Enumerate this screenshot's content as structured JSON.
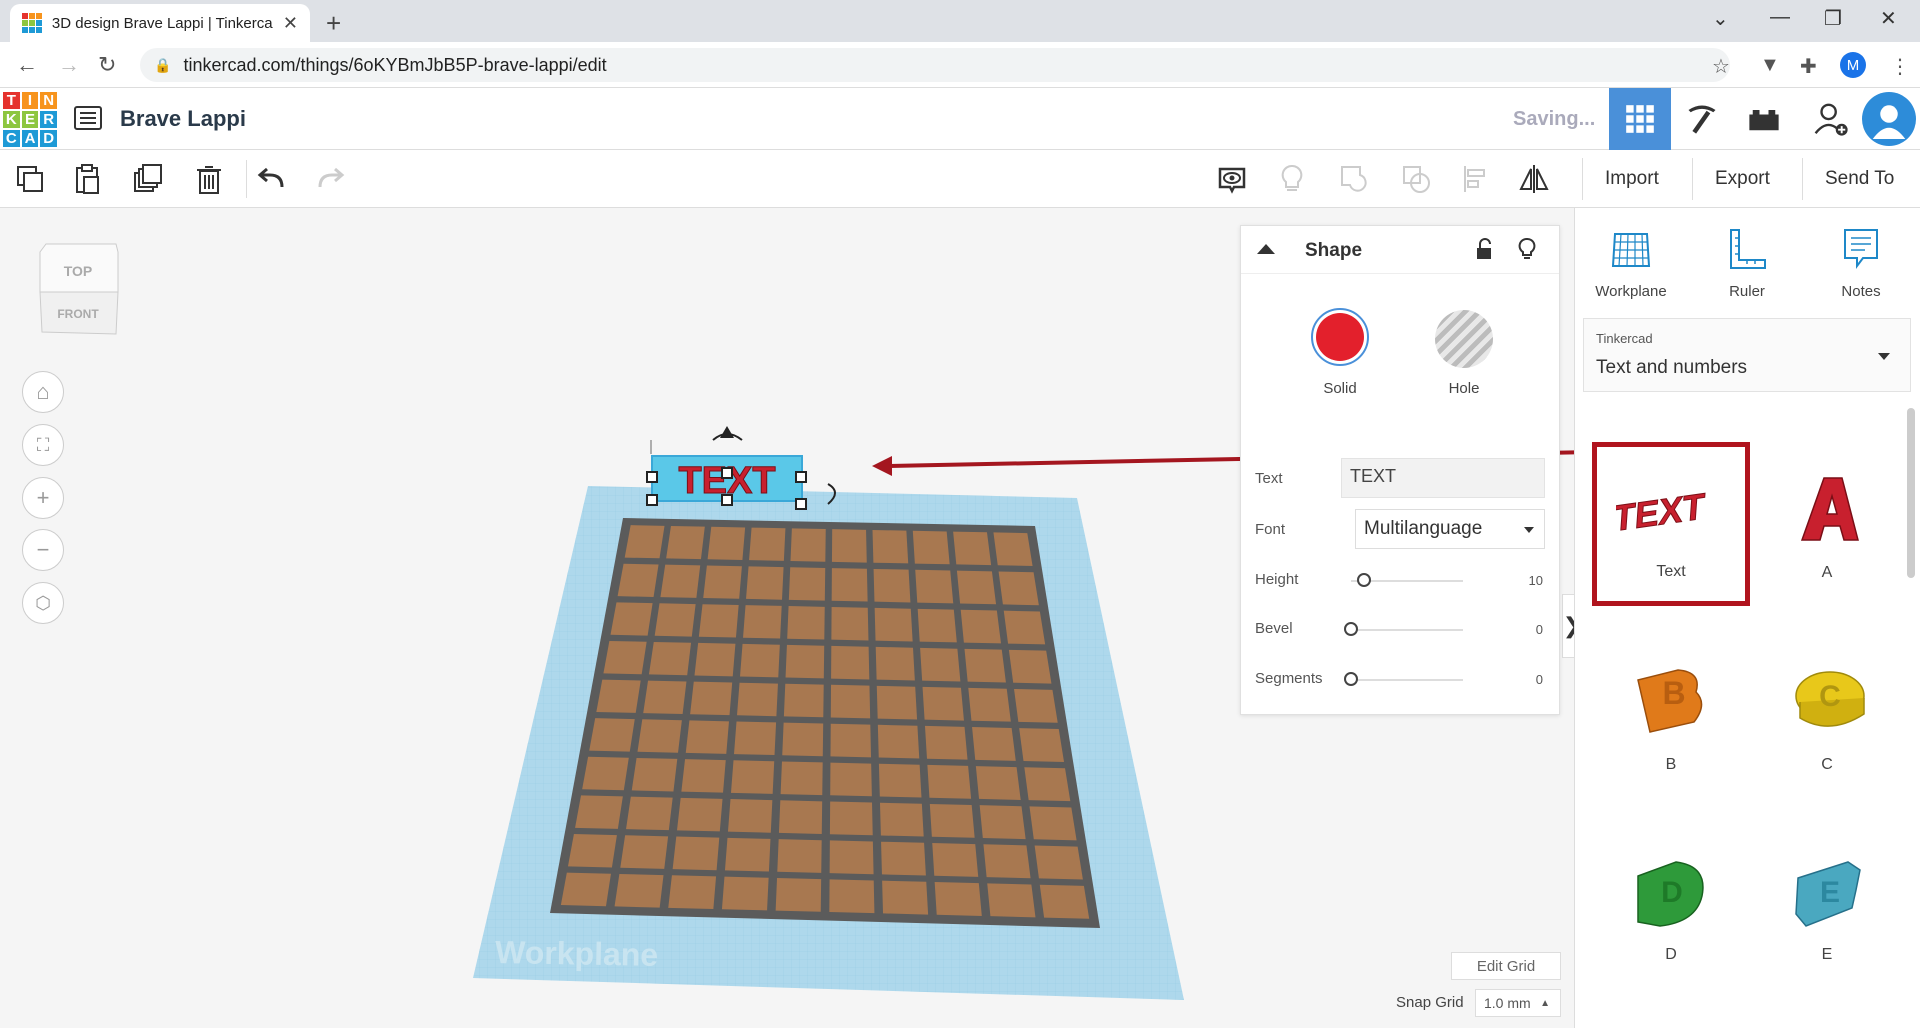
{
  "browser": {
    "tab_title": "3D design Brave Lappi | Tinkercad",
    "url": "tinkercad.com/things/6oKYBmJbB5P-brave-lappi/edit",
    "profile_initial": "M"
  },
  "app": {
    "logo_letters": [
      "T",
      "I",
      "N",
      "K",
      "E",
      "R",
      "C",
      "A",
      "D"
    ],
    "design_name": "Brave Lappi",
    "status": "Saving...",
    "actions": {
      "import": "Import",
      "export": "Export",
      "send_to": "Send To"
    }
  },
  "viewcube": {
    "top": "TOP",
    "front": "FRONT"
  },
  "scene": {
    "workplane_label": "Workplane",
    "object_label": "TEXT"
  },
  "shape_panel": {
    "title": "Shape",
    "solid_label": "Solid",
    "hole_label": "Hole",
    "solid_color": "#e3202c",
    "text_label": "Text",
    "text_value": "TEXT",
    "font_label": "Font",
    "font_value": "Multilanguage",
    "height_label": "Height",
    "height_value": "10",
    "height_level": 0.12,
    "bevel_label": "Bevel",
    "bevel_value": "0",
    "bevel_level": 0,
    "segments_label": "Segments",
    "segments_value": "0",
    "segments_level": 0
  },
  "grid_controls": {
    "edit_grid": "Edit Grid",
    "snap_label": "Snap Grid",
    "snap_value": "1.0 mm"
  },
  "sidebar": {
    "tools": [
      {
        "label": "Workplane",
        "icon": "workplane-icon"
      },
      {
        "label": "Ruler",
        "icon": "ruler-icon"
      },
      {
        "label": "Notes",
        "icon": "notes-icon"
      }
    ],
    "library_category": "Tinkercad",
    "library_value": "Text and numbers",
    "shapes": [
      {
        "label": "Text",
        "color": "#c8202e"
      },
      {
        "label": "A",
        "color": "#c8202e"
      },
      {
        "label": "B",
        "color": "#e07a1a"
      },
      {
        "label": "C",
        "color": "#e8c81a"
      },
      {
        "label": "D",
        "color": "#2e9a3a"
      },
      {
        "label": "E",
        "color": "#4aa8c0"
      }
    ]
  },
  "colors": {
    "accent": "#4a90d9",
    "highlight": "#b0141e",
    "arrow": "#a4161f",
    "workplane": "#aed8ec",
    "tiles": "#a87850"
  }
}
